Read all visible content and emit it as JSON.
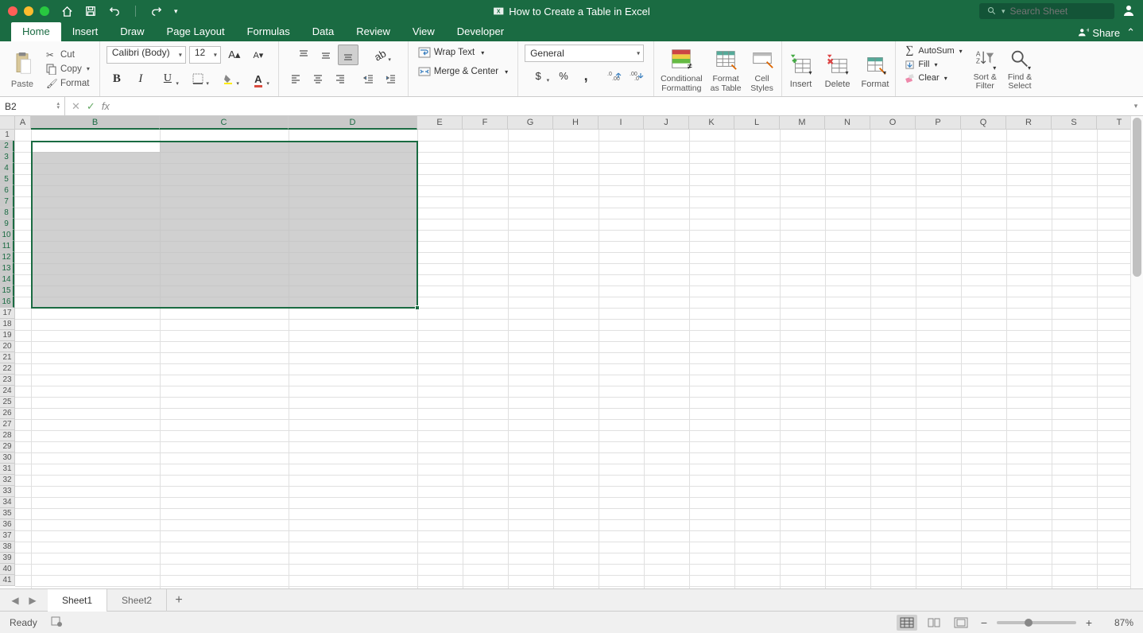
{
  "titlebar": {
    "document_title": "How to Create a Table in Excel",
    "search_placeholder": "Search Sheet"
  },
  "ribbon": {
    "tabs": [
      "Home",
      "Insert",
      "Draw",
      "Page Layout",
      "Formulas",
      "Data",
      "Review",
      "View",
      "Developer"
    ],
    "active_tab": "Home",
    "share_label": "Share"
  },
  "clipboard": {
    "paste": "Paste",
    "cut": "Cut",
    "copy": "Copy",
    "format": "Format"
  },
  "font": {
    "name": "Calibri (Body)",
    "size": "12"
  },
  "alignment": {
    "wrap_text": "Wrap Text",
    "merge_center": "Merge & Center"
  },
  "number": {
    "format": "General"
  },
  "styles": {
    "conditional_formatting": "Conditional\nFormatting",
    "format_as_table": "Format\nas Table",
    "cell_styles": "Cell\nStyles"
  },
  "cells": {
    "insert": "Insert",
    "delete": "Delete",
    "format": "Format"
  },
  "editing": {
    "autosum": "AutoSum",
    "fill": "Fill",
    "clear": "Clear",
    "sort_filter": "Sort &\nFilter",
    "find_select": "Find &\nSelect"
  },
  "formula_bar": {
    "cell_ref": "B2",
    "formula": ""
  },
  "grid": {
    "columns": [
      "A",
      "B",
      "C",
      "D",
      "E",
      "F",
      "G",
      "H",
      "I",
      "J",
      "K",
      "L",
      "M",
      "N",
      "O",
      "P",
      "Q",
      "R",
      "S",
      "T"
    ],
    "col_widths": {
      "A": 20,
      "default": 57,
      "wide": 162
    },
    "wide_cols": [
      "B",
      "C",
      "D"
    ],
    "selected_cols": [
      "B",
      "C",
      "D"
    ],
    "row_count": 41,
    "selected_rows_start": 2,
    "selected_rows_end": 16,
    "active_cell": "B2",
    "selection": "B2:D16"
  },
  "sheets": {
    "tabs": [
      "Sheet1",
      "Sheet2"
    ],
    "active": "Sheet1"
  },
  "status": {
    "state": "Ready",
    "zoom": "87%"
  }
}
